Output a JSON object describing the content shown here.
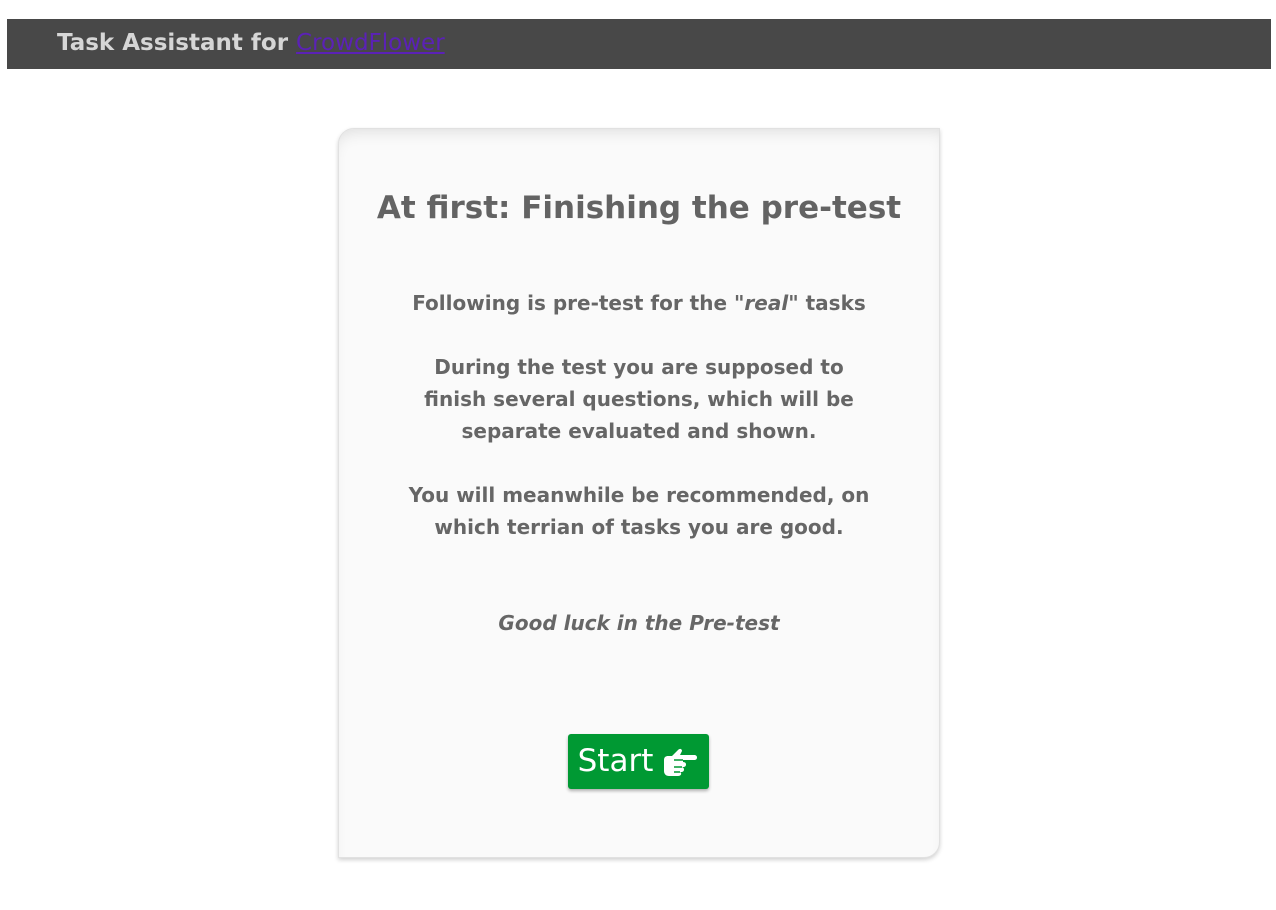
{
  "header": {
    "title_prefix": "Task Assistant for ",
    "link_text": "CrowdFlower"
  },
  "card": {
    "title": "At first: Finishing the pre-test",
    "para1_before": "Following is pre-test for the ",
    "para1_emph": "\"real\"",
    "para1_after": " tasks",
    "para2": "During the test you are supposed to finish several questions, which will be separate evaluated and shown.",
    "para3": "You will meanwhile be recommended, on which terrian of tasks you are good.",
    "good_luck": "Good luck in the Pre-test",
    "start_label": "Start",
    "start_icon": "hand-point-right-icon"
  },
  "colors": {
    "header_bg": "#484848",
    "start_button": "#009933",
    "link": "#5b21b6"
  }
}
